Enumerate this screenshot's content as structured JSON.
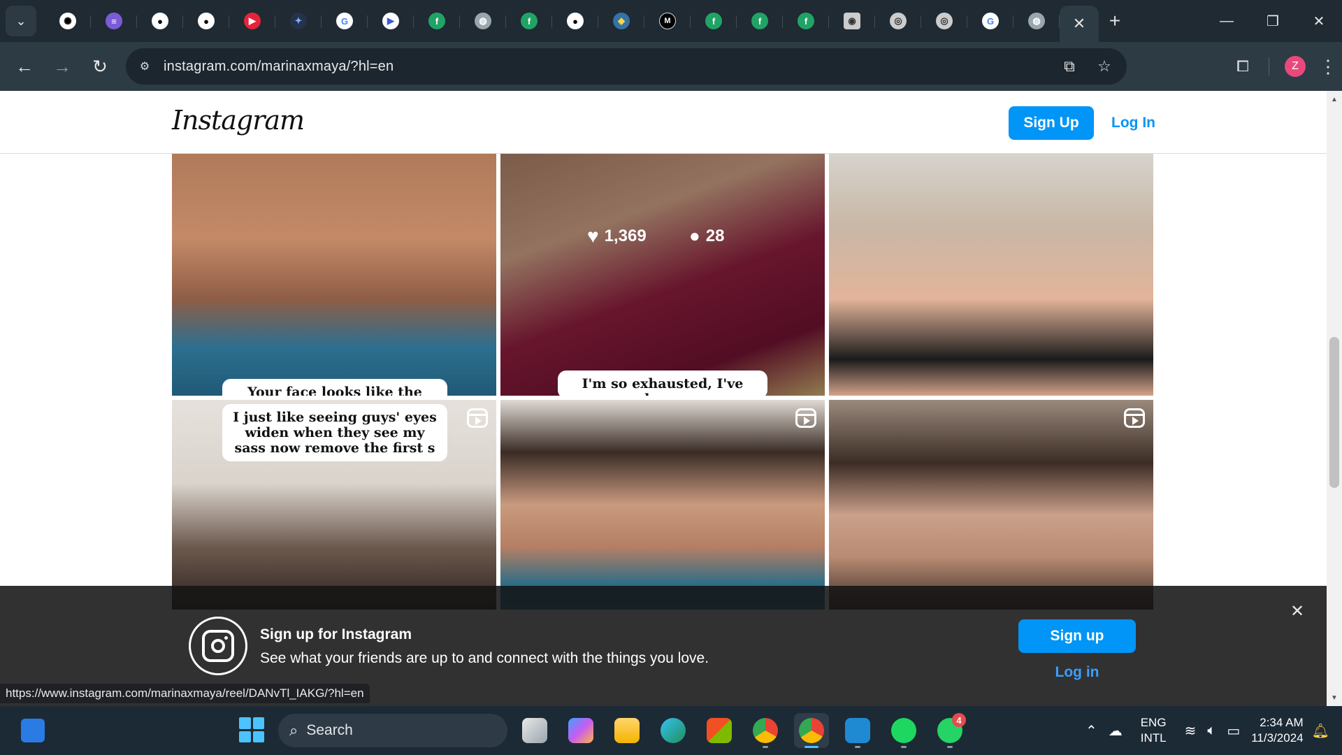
{
  "browser": {
    "tab_favicons": [
      "chatgpt-icon",
      "stack-icon",
      "github-icon",
      "github-icon",
      "youtube-music-icon",
      "gemini-icon",
      "google-icon",
      "play-icon",
      "feedly-icon",
      "globe-icon",
      "feedly-icon",
      "github-icon",
      "python-icon",
      "medium-icon",
      "feedly-icon",
      "feedly-icon",
      "feedly-icon",
      "extension-icon",
      "circle-icon",
      "circle-icon",
      "google-icon",
      "globe-icon"
    ],
    "active_tab_close": "✕",
    "new_tab": "+",
    "url": "instagram.com/marinaxmaya/?hl=en",
    "profile_initial": "Z",
    "status_url": "https://www.instagram.com/marinaxmaya/reel/DANvTl_IAKG/?hl=en"
  },
  "instagram": {
    "logo": "Instagram",
    "header_signup": "Sign Up",
    "header_login": "Log In",
    "posts": [
      {
        "caption": "Your face looks like the",
        "likes": "",
        "comments": "",
        "reel": false
      },
      {
        "caption": "I'm so exhausted, I've been",
        "likes": "1,369",
        "comments": "28",
        "reel": false
      },
      {
        "caption": "",
        "likes": "",
        "comments": "",
        "reel": false
      },
      {
        "caption": "I just like seeing guys' eyes widen when they see my sass now remove the first s",
        "likes": "",
        "comments": "",
        "reel": true
      },
      {
        "caption": "",
        "likes": "",
        "comments": "",
        "reel": true
      },
      {
        "caption": "",
        "likes": "",
        "comments": "",
        "reel": true
      }
    ],
    "banner": {
      "title": "Sign up for Instagram",
      "subtitle": "See what your friends are up to and connect with the things you love.",
      "signup": "Sign up",
      "login": "Log in",
      "close": "✕"
    }
  },
  "taskbar": {
    "search_label": "Search",
    "apps": [
      "task-view-icon",
      "copilot-icon",
      "file-explorer-icon",
      "edge-icon",
      "store-icon",
      "chrome-icon",
      "chrome-profile-icon",
      "vscode-icon",
      "spotify-icon",
      "whatsapp-icon"
    ],
    "whatsapp_badge": "4",
    "lang_top": "ENG",
    "lang_bottom": "INTL",
    "time": "2:34 AM",
    "date": "11/3/2024"
  },
  "colors": {
    "accent": "#0095f6",
    "chrome_dark": "#1f2a33",
    "taskbar": "#1c2a36"
  }
}
